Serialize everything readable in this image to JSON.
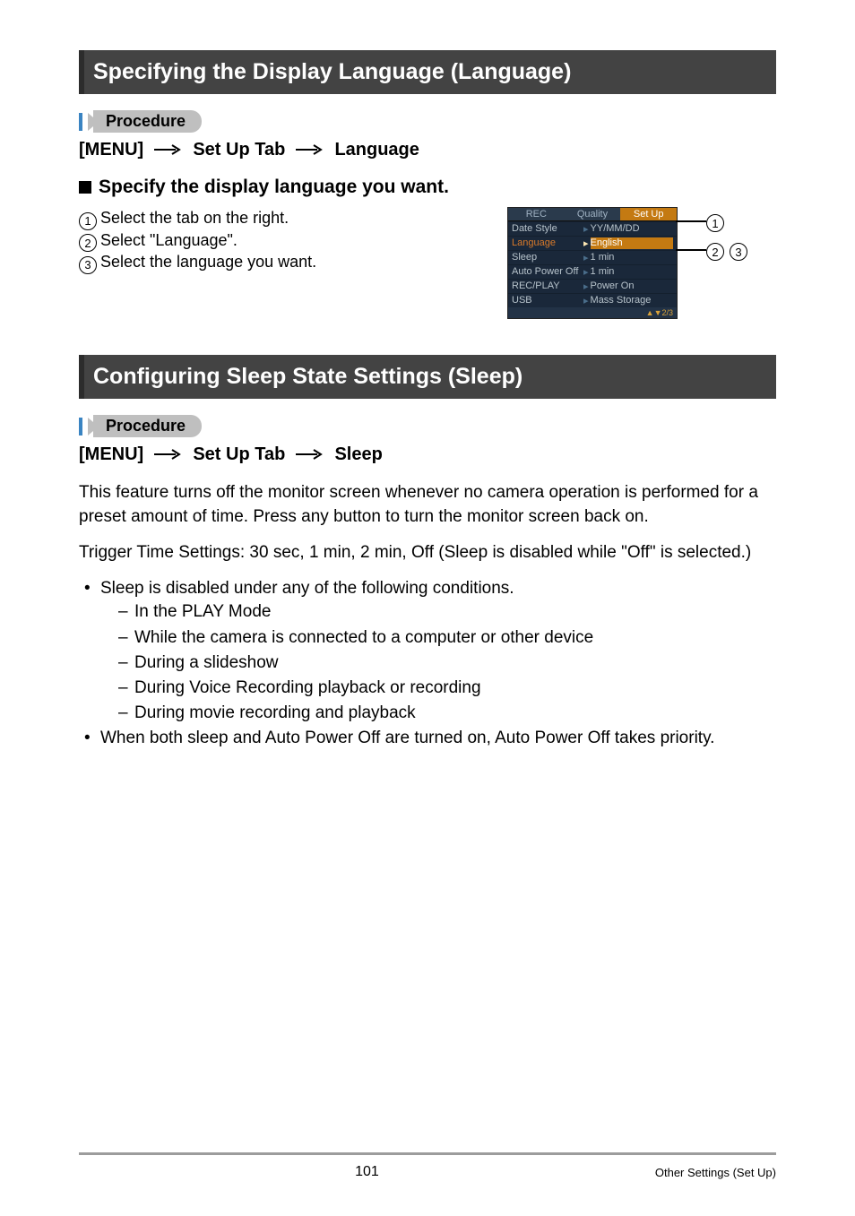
{
  "section1": {
    "title": "Specifying the Display Language (Language)",
    "procedure_label": "Procedure",
    "breadcrumb": {
      "a": "[MENU]",
      "b": "Set Up Tab",
      "c": "Language"
    },
    "subhead": "Specify the display language you want.",
    "steps": [
      "Select the tab on the right.",
      "Select \"Language\".",
      "Select the language you want."
    ],
    "lcd": {
      "tabs": [
        "REC",
        "Quality",
        "Set Up"
      ],
      "rows": [
        {
          "k": "Date Style",
          "v": "YY/MM/DD"
        },
        {
          "k": "Language",
          "v": "English",
          "hl": true
        },
        {
          "k": "Sleep",
          "v": "1 min"
        },
        {
          "k": "Auto Power Off",
          "v": "1 min"
        },
        {
          "k": "REC/PLAY",
          "v": "Power On"
        },
        {
          "k": "USB",
          "v": "Mass Storage"
        }
      ],
      "footer": "▲▼2/3"
    },
    "callouts": {
      "c1": "1",
      "c2": "2",
      "c3": "3"
    }
  },
  "section2": {
    "title": "Configuring Sleep State Settings (Sleep)",
    "procedure_label": "Procedure",
    "breadcrumb": {
      "a": "[MENU]",
      "b": "Set Up Tab",
      "c": "Sleep"
    },
    "para1": "This feature turns off the monitor screen whenever no camera operation is performed for a preset amount of time. Press any button to turn the monitor screen back on.",
    "para2": "Trigger Time Settings: 30 sec, 1 min, 2 min, Off (Sleep is disabled while \"Off\" is selected.)",
    "bullet1": "Sleep is disabled under any of the following conditions.",
    "dashes": [
      "In the PLAY Mode",
      "While the camera is connected to a computer or other device",
      "During a slideshow",
      "During Voice Recording playback or recording",
      "During movie recording and playback"
    ],
    "bullet2": "When both sleep and Auto Power Off are turned on, Auto Power Off takes priority."
  },
  "footer": {
    "page": "101",
    "section": "Other Settings (Set Up)"
  }
}
